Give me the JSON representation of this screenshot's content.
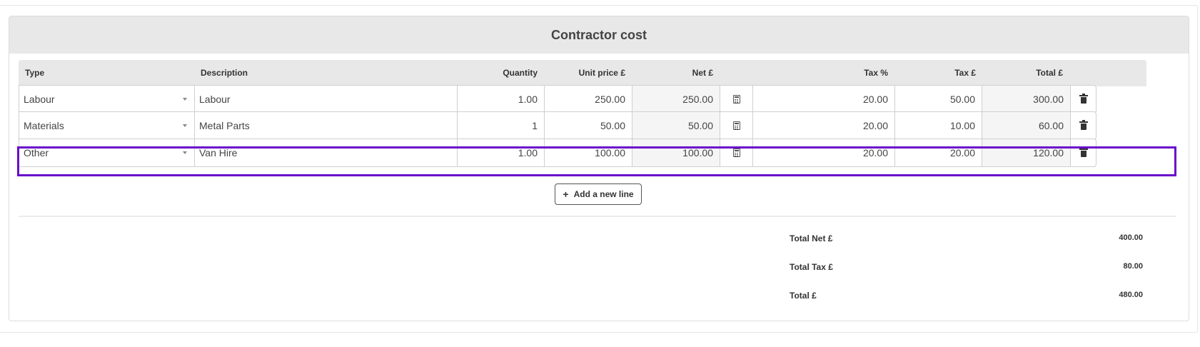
{
  "card": {
    "title": "Contractor cost"
  },
  "columns": {
    "type": "Type",
    "description": "Description",
    "quantity": "Quantity",
    "unit_price": "Unit price £",
    "net": "Net £",
    "tax_pct": "Tax %",
    "tax": "Tax £",
    "total": "Total £"
  },
  "rows": [
    {
      "type": "Labour",
      "description": "Labour",
      "quantity": "1.00",
      "unit_price": "250.00",
      "net": "250.00",
      "tax_pct": "20.00",
      "tax": "50.00",
      "total": "300.00"
    },
    {
      "type": "Materials",
      "description": "Metal Parts",
      "quantity": "1",
      "unit_price": "50.00",
      "net": "50.00",
      "tax_pct": "20.00",
      "tax": "10.00",
      "total": "60.00"
    },
    {
      "type": "Other",
      "description": "Van Hire",
      "quantity": "1.00",
      "unit_price": "100.00",
      "net": "100.00",
      "tax_pct": "20.00",
      "tax": "20.00",
      "total": "120.00"
    }
  ],
  "highlighted_row": 2,
  "highlight_color": "#6a0dc9",
  "icons": {
    "calculator": "calculator-icon",
    "delete": "trash-icon",
    "dropdown": "chevron-down-icon",
    "add": "plus-icon"
  },
  "add_line_label": "Add a new line",
  "totals": {
    "net_label": "Total Net £",
    "net_value": "400.00",
    "tax_label": "Total Tax £",
    "tax_value": "80.00",
    "total_label": "Total £",
    "total_value": "480.00"
  }
}
